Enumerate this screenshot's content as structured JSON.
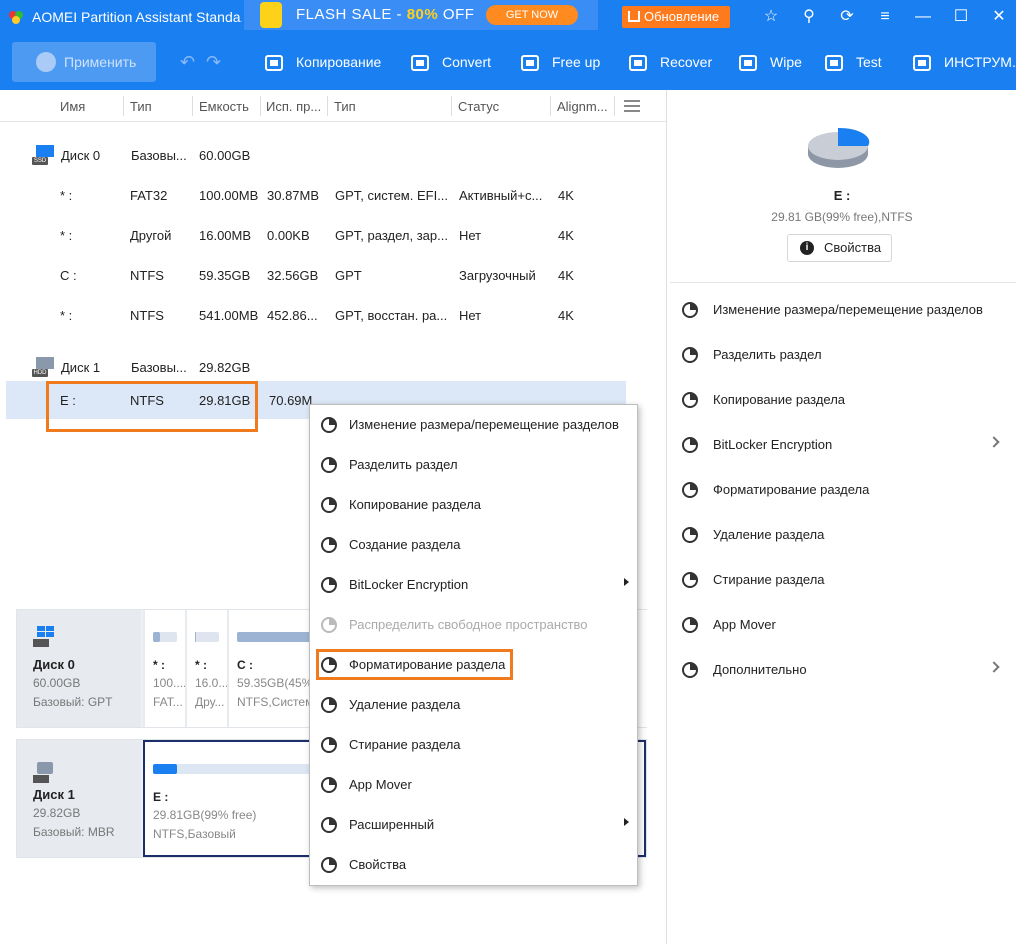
{
  "window": {
    "title": "AOMEI Partition Assistant Standa...",
    "promo": {
      "text": "FLASH SALE - ",
      "percent": "80%",
      "suffix": " OFF",
      "button": "GET NOW"
    },
    "update_label": "Обновление"
  },
  "toolbar": {
    "apply_label": "Применить",
    "tools": [
      {
        "label": "Копирование",
        "icon": "copy-icon"
      },
      {
        "label": "Convert",
        "icon": "convert-icon"
      },
      {
        "label": "Free up",
        "icon": "free-up-icon"
      },
      {
        "label": "Recover",
        "icon": "recover-icon"
      },
      {
        "label": "Wipe",
        "icon": "wipe-icon"
      },
      {
        "label": "Test",
        "icon": "test-icon"
      },
      {
        "label": "ИНСТРУМ.",
        "icon": "tools-icon"
      }
    ]
  },
  "columns": [
    "Имя",
    "Тип",
    "Емкость",
    "Исп. пр...",
    "Тип",
    "Статус",
    "Alignm..."
  ],
  "disks": [
    {
      "name": "Диск 0",
      "badge": "SSD",
      "type": "Базовы...",
      "capacity": "60.00GB",
      "partitions": [
        {
          "name": "* :",
          "fs": "FAT32",
          "capacity": "100.00MB",
          "used": "30.87MB",
          "ptype": "GPT, систем. EFI...",
          "status": "Активный+с...",
          "align": "4K"
        },
        {
          "name": "* :",
          "fs": "Другой",
          "capacity": "16.00MB",
          "used": "0.00KB",
          "ptype": "GPT, раздел, зар...",
          "status": "Нет",
          "align": "4K"
        },
        {
          "name": "C :",
          "fs": "NTFS",
          "capacity": "59.35GB",
          "used": "32.56GB",
          "ptype": "GPT",
          "status": "Загрузочный",
          "align": "4K"
        },
        {
          "name": "* :",
          "fs": "NTFS",
          "capacity": "541.00MB",
          "used": "452.86...",
          "ptype": "GPT, восстан. ра...",
          "status": "Нет",
          "align": "4K"
        }
      ]
    },
    {
      "name": "Диск 1",
      "badge": "HDD",
      "type": "Базовы...",
      "capacity": "29.82GB",
      "partitions": [
        {
          "name": "E :",
          "fs": "NTFS",
          "capacity": "29.81GB",
          "used": "70.69M"
        }
      ]
    }
  ],
  "disk_map": [
    {
      "name": "Диск 0",
      "size": "60.00GB",
      "type": "Базовый: GPT",
      "parts": [
        {
          "label": "* :",
          "size": "100....",
          "type": "FAT...",
          "used_fraction": 0.3
        },
        {
          "label": "* :",
          "size": "16.0...",
          "type": "Дру...",
          "used_fraction": 0
        },
        {
          "label": "C :",
          "size": "59.35GB(45%",
          "type": "NTFS,Систем",
          "used_fraction": 0.55
        }
      ]
    },
    {
      "name": "Диск 1",
      "size": "29.82GB",
      "type": "Базовый: MBR",
      "parts": [
        {
          "label": "E :",
          "size": "29.81GB(99% free)",
          "type": "NTFS,Базовый",
          "used_fraction": 0.01
        }
      ]
    }
  ],
  "context_menu": [
    {
      "label": "Изменение размера/перемещение разделов",
      "icon": "resize-move-icon"
    },
    {
      "label": "Разделить раздел",
      "icon": "split-partition-icon"
    },
    {
      "label": "Копирование раздела",
      "icon": "copy-partition-icon"
    },
    {
      "label": "Создание раздела",
      "icon": "create-partition-icon"
    },
    {
      "label": "BitLocker Encryption",
      "icon": "lock-icon",
      "submenu": true
    },
    {
      "label": "Распределить свободное пространство",
      "icon": "allocate-space-icon",
      "disabled": true
    },
    {
      "label": "Форматирование раздела",
      "icon": "format-partition-icon",
      "highlighted": true
    },
    {
      "label": "Удаление раздела",
      "icon": "trash-icon"
    },
    {
      "label": "Стирание раздела",
      "icon": "eraser-icon"
    },
    {
      "label": "App Mover",
      "icon": "app-mover-icon"
    },
    {
      "label": "Расширенный",
      "icon": "more-icon",
      "submenu": true
    },
    {
      "label": "Свойства",
      "icon": "info-icon"
    }
  ],
  "right_panel": {
    "partition_name": "E :",
    "partition_info": "29.81 GB(99% free),NTFS",
    "properties_label": "Свойства",
    "actions": [
      {
        "label": "Изменение размера/перемещение разделов",
        "icon": "resize-move-icon"
      },
      {
        "label": "Разделить раздел",
        "icon": "split-partition-icon"
      },
      {
        "label": "Копирование раздела",
        "icon": "copy-partition-icon"
      },
      {
        "label": "BitLocker Encryption",
        "icon": "lock-icon",
        "submenu": true
      },
      {
        "label": "Форматирование раздела",
        "icon": "format-partition-icon"
      },
      {
        "label": "Удаление раздела",
        "icon": "trash-icon"
      },
      {
        "label": "Стирание раздела",
        "icon": "eraser-icon"
      },
      {
        "label": "App Mover",
        "icon": "app-mover-icon"
      },
      {
        "label": "Дополнительно",
        "icon": "more-icon",
        "submenu": true
      }
    ]
  },
  "colors": {
    "brand": "#1a7ff0",
    "highlight": "#f07b1e",
    "selected_row": "#dce8f7"
  }
}
